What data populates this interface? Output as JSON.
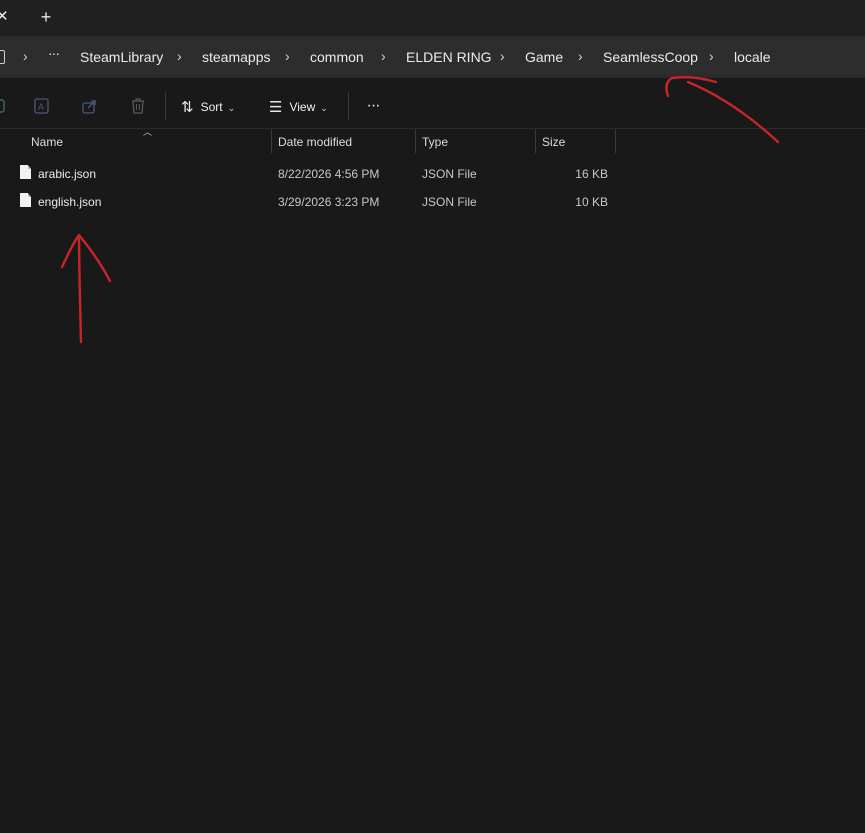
{
  "tabstrip": {
    "close_glyph": "✕",
    "new_tab_glyph": "+"
  },
  "breadcrumb": {
    "overflow": "···",
    "items": [
      "SteamLibrary",
      "steamapps",
      "common",
      "ELDEN RING",
      "Game",
      "SeamlessCoop",
      "locale"
    ],
    "separator": "›"
  },
  "toolbar": {
    "sort_label": "Sort",
    "view_label": "View",
    "more_label": "···"
  },
  "columns": [
    "Name",
    "Date modified",
    "Type",
    "Size"
  ],
  "files": [
    {
      "name": "arabic.json",
      "date": "8/22/2026 4:56 PM",
      "type": "JSON File",
      "size": "16 KB"
    },
    {
      "name": "english.json",
      "date": "3/29/2026 3:23 PM",
      "type": "JSON File",
      "size": "10 KB"
    }
  ],
  "annotation_color": "#c8252b",
  "theme": {
    "background": "#191919",
    "address_bar": "#2b2b2b"
  }
}
